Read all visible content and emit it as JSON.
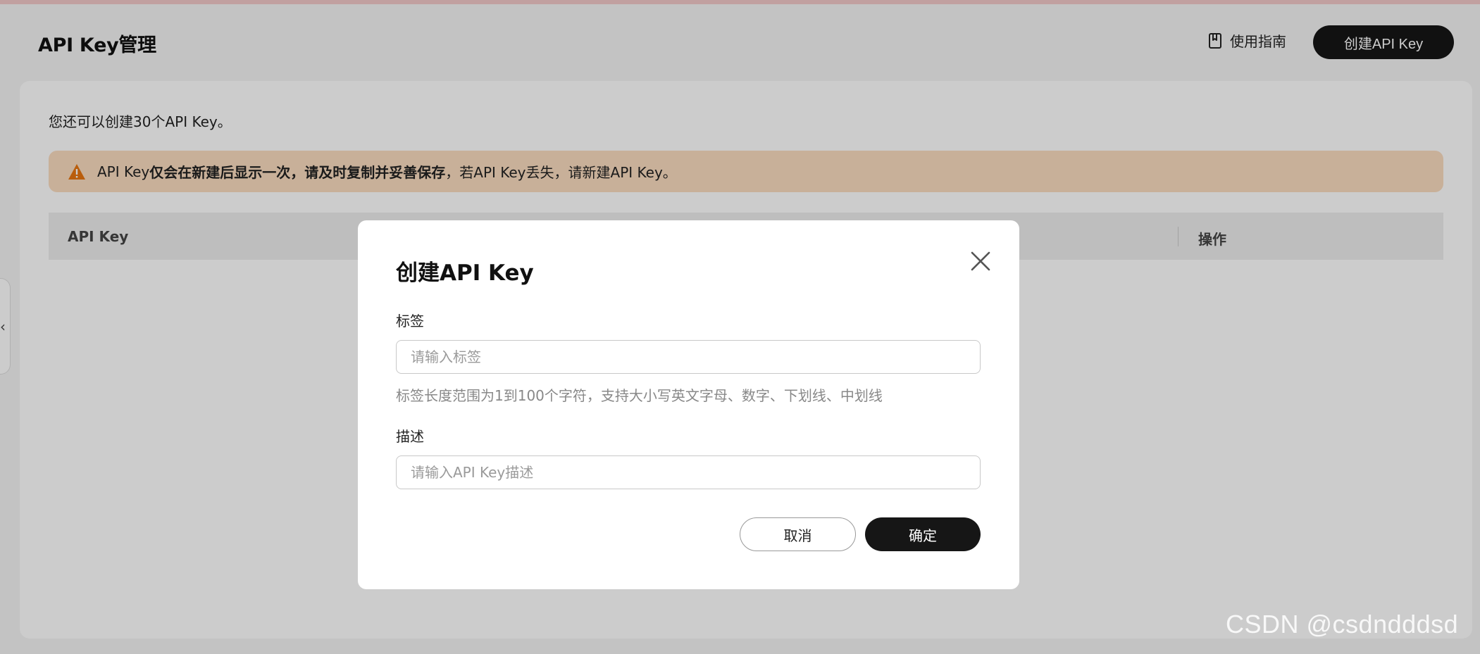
{
  "header": {
    "title": "API Key管理",
    "guide_label": "使用指南",
    "create_button": "创建API Key"
  },
  "main": {
    "quota_text": "您还可以创建30个API Key。",
    "warning": {
      "prefix": "API Key",
      "bold": "仅会在新建后显示一次，请及时复制并妥善保存",
      "suffix": "，若API Key丢失，请新建API Key。"
    },
    "table": {
      "columns": [
        "API Key",
        "操作"
      ]
    }
  },
  "modal": {
    "title": "创建API Key",
    "tag_label": "标签",
    "tag_placeholder": "请输入标签",
    "tag_hint": "标签长度范围为1到100个字符，支持大小写英文字母、数字、下划线、中划线",
    "desc_label": "描述",
    "desc_placeholder": "请输入API Key描述",
    "cancel_label": "取消",
    "ok_label": "确定"
  },
  "watermark": "CSDN @csdndddsd",
  "colors": {
    "primary_button": "#161616",
    "warning_bg": "#fbdcc0",
    "warning_icon": "#e8750f",
    "page_bg": "#f4f4f4"
  },
  "icons": {
    "guide": "book-icon",
    "warning": "warning-triangle-icon",
    "close": "close-icon",
    "side": "chevron-left-icon"
  }
}
